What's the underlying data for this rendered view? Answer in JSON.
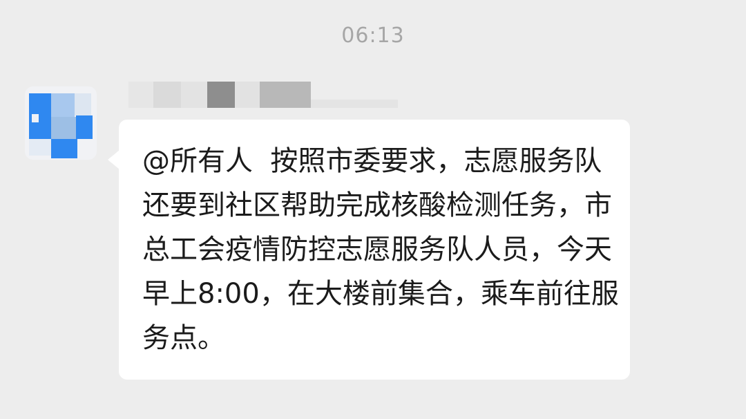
{
  "chat": {
    "timestamp": "06:13",
    "message": {
      "text": "@所有人  按照市委要求，志愿服务队还要到社区帮助完成核酸检测任务，市总工会疫情防控志愿服务队人员，今天早上8:00，在大楼前集合，乘车前往服务点。"
    }
  },
  "colors": {
    "background": "#ededed",
    "bubble": "#ffffff",
    "text": "#1b1b1b",
    "timestamp": "#a6a6a6",
    "avatar_accent": "#2f88f0"
  },
  "icons": {
    "avatar": "pixelated-avatar"
  }
}
